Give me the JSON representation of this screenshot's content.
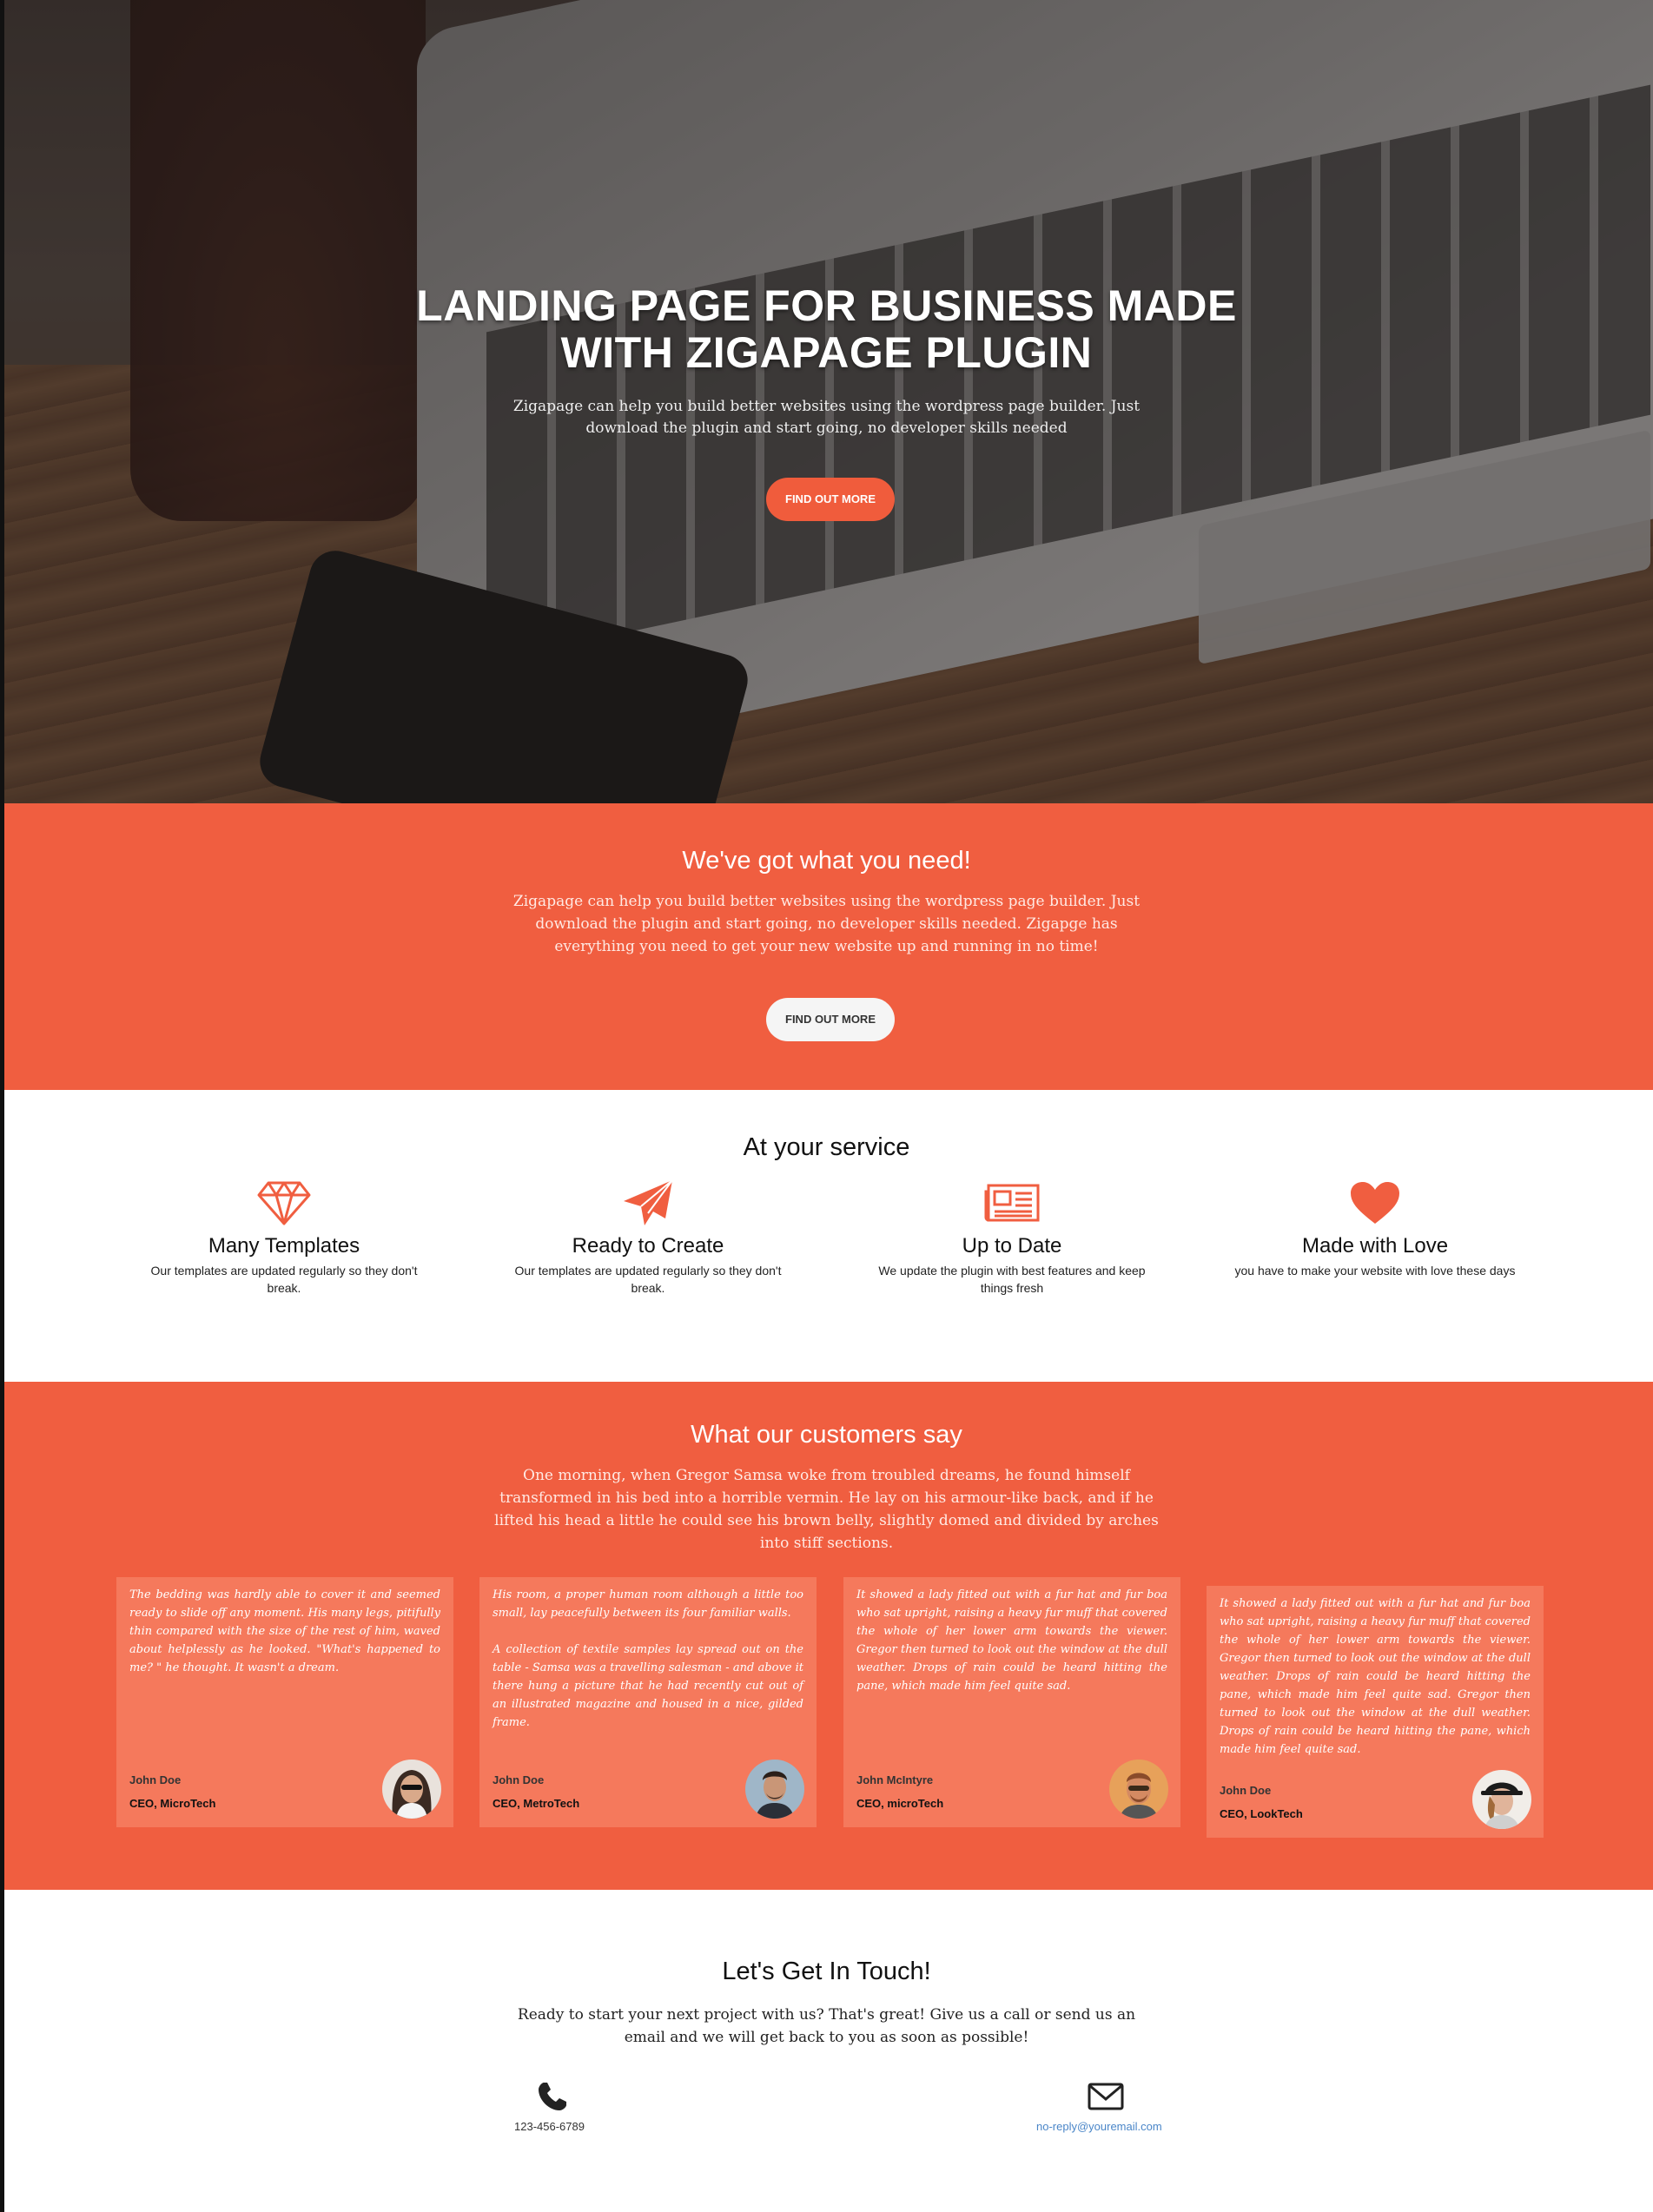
{
  "colors": {
    "accent": "#f05e40",
    "card": "#f5795c",
    "link": "#4a86c8"
  },
  "hero": {
    "title_line1": "LANDING PAGE FOR BUSINESS MADE",
    "title_line2": "WITH ZIGAPAGE PLUGIN",
    "subtitle": "Zigapage can help you build better websites using the wordpress page builder. Just download the plugin and start going, no developer skills needed",
    "button": "FIND OUT MORE"
  },
  "need": {
    "heading": "We've got what you need!",
    "text": "Zigapage can help you build better websites using the wordpress page builder. Just download the plugin and start going, no developer skills needed. Zigapge has everything you need to get your new website up and running in no time!",
    "button": "FIND OUT MORE"
  },
  "service": {
    "heading": "At your service",
    "features": [
      {
        "icon": "diamond-icon",
        "title": "Many Templates",
        "text": "Our templates are updated regularly so they don't break."
      },
      {
        "icon": "paper-plane-icon",
        "title": "Ready to Create",
        "text": "Our templates are updated regularly so they don't break."
      },
      {
        "icon": "newspaper-icon",
        "title": "Up to Date",
        "text": "We update the plugin with best features and keep things fresh"
      },
      {
        "icon": "heart-icon",
        "title": "Made with Love",
        "text": "you have to make your website with love these days"
      }
    ]
  },
  "testimonials": {
    "heading": "What our customers say",
    "lead": "One morning, when Gregor Samsa woke from troubled dreams, he found himself transformed in his bed into a horrible vermin. He lay on his armour-like back, and if he lifted his head a little he could see his brown belly, slightly domed and divided by arches into stiff sections.",
    "items": [
      {
        "quote": "The bedding was hardly able to cover it and seemed ready to slide off any moment. His many legs, pitifully thin compared with the size of the rest of him, waved about helplessly as he looked. \"What's happened to me? \" he thought. It wasn't a dream.",
        "name": "John Doe",
        "role": "CEO, MicroTech"
      },
      {
        "quote": "His room, a proper human room although a little too small, lay peacefully between its four familiar walls.\n\nA collection of textile samples lay spread out on the table - Samsa was a travelling salesman - and above it there hung a picture that he had recently cut out of an illustrated magazine and housed in a nice, gilded frame.",
        "name": "John Doe",
        "role": "CEO, MetroTech"
      },
      {
        "quote": "It showed a lady fitted out with a fur hat and fur boa who sat upright, raising a heavy fur muff that covered the whole of her lower arm towards the viewer. Gregor then turned to look out the window at the dull weather. Drops of rain could be heard hitting the pane, which made him feel quite sad.",
        "name": "John McIntyre",
        "role": "CEO, microTech"
      },
      {
        "quote": "It showed a lady fitted out with a fur hat and fur boa who sat upright, raising a heavy fur muff that covered the whole of her lower arm towards the viewer. Gregor then turned to look out the window at the dull weather. Drops of rain could be heard hitting the pane, which made him feel quite sad. Gregor then turned to look out the window at the dull weather. Drops of rain could be heard hitting the pane, which made him feel quite sad.",
        "name": "John Doe",
        "role": "CEO, LookTech"
      }
    ]
  },
  "contact": {
    "heading": "Let's Get In Touch!",
    "text": "Ready to start your next project with us? That's great! Give us a call or send us an email and we will get back to you as soon as possible!",
    "phone": "123-456-6789",
    "email": "no-reply@youremail.com"
  }
}
